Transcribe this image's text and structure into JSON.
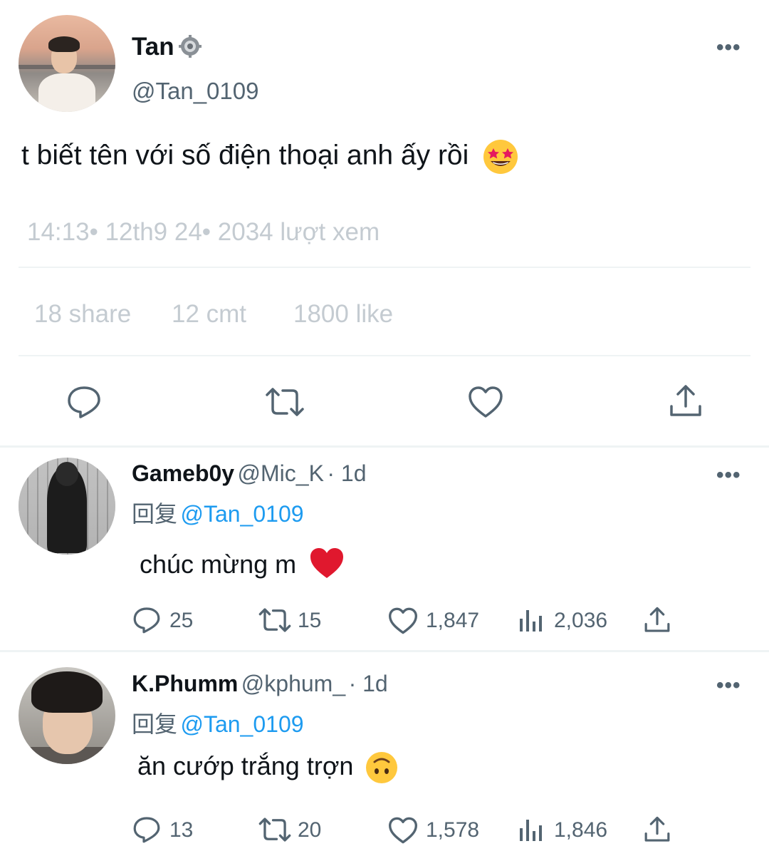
{
  "tweet": {
    "author_name": "Tan",
    "author_handle": "@Tan_0109",
    "text": "t biết tên với số điện thoại anh ấy rồi",
    "meta": "14:13• 12th9 24• 2034 lượt xem",
    "stats": {
      "shares": "18 share",
      "comments": "12 cmt",
      "likes": "1800 like"
    },
    "more_label": "•••"
  },
  "replies": [
    {
      "name": "Gameb0y",
      "handle": "@Mic_K",
      "age": "· 1d",
      "reply_to_label": "回复",
      "reply_to_handle": "@Tan_0109",
      "text": "chúc mừng m",
      "counts": {
        "replies": "25",
        "retweets": "15",
        "likes": "1,847",
        "views": "2,036"
      }
    },
    {
      "name": "K.Phumm",
      "handle": "@kphum_",
      "age": "· 1d",
      "reply_to_label": "回复",
      "reply_to_handle": "@Tan_0109",
      "text": "ăn cướp trắng trợn",
      "counts": {
        "replies": "13",
        "retweets": "20",
        "likes": "1,578",
        "views": "1,846"
      }
    }
  ],
  "colors": {
    "link": "#1d9bf0",
    "secondary_text": "#536471",
    "faded_text": "#c4cbd1",
    "icon": "#536471",
    "heart_emoji": "#e0182e"
  },
  "icons": [
    "gear-icon",
    "more-icon",
    "reply-icon",
    "retweet-icon",
    "like-icon",
    "share-icon",
    "views-icon",
    "star-struck-emoji",
    "red-heart-emoji",
    "upside-down-face-emoji"
  ]
}
